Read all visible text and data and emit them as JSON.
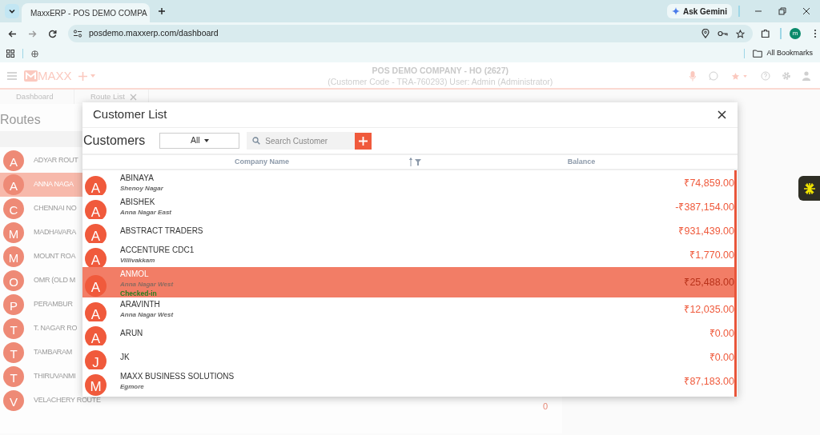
{
  "browser": {
    "tab_title": "MaxxERP - POS DEMO COMPA",
    "ask_gemini": "Ask Gemini",
    "url": "posdemo.maxxerp.com/dashboard",
    "bookmarks_label": "All Bookmarks",
    "profile_initial": "m"
  },
  "app_header": {
    "logo_text": "MAXX",
    "company": "POS DEMO COMPANY - HO (2627)",
    "user_line": "(Customer Code - TRA-760293) User: Admin (Administrator)"
  },
  "tabs": [
    {
      "label": "Dashboard",
      "closable": false
    },
    {
      "label": "Route List",
      "closable": true
    }
  ],
  "routes": {
    "title": "Routes",
    "items": [
      {
        "initial": "A",
        "label": "ADYAR ROUT",
        "selected": false
      },
      {
        "initial": "A",
        "label": "ANNA NAGA",
        "selected": true
      },
      {
        "initial": "C",
        "label": "CHENNAI NO",
        "selected": false
      },
      {
        "initial": "M",
        "label": "MADHAVARA",
        "selected": false
      },
      {
        "initial": "M",
        "label": "MOUNT ROA",
        "selected": false
      },
      {
        "initial": "O",
        "label": "OMR (OLD M",
        "selected": false
      },
      {
        "initial": "P",
        "label": "PERAMBUR",
        "selected": false
      },
      {
        "initial": "T",
        "label": "T. NAGAR RO",
        "selected": false
      },
      {
        "initial": "T",
        "label": "TAMBARAM",
        "selected": false
      },
      {
        "initial": "T",
        "label": "THIRUVANMI",
        "selected": false
      },
      {
        "initial": "V",
        "label": "VELACHERY ROUTE",
        "selected": false,
        "count": "0"
      }
    ]
  },
  "dialog": {
    "title": "Customer List",
    "heading": "Customers",
    "filter": "All",
    "search_placeholder": "Search Customer",
    "columns": [
      "Company Name",
      "Balance"
    ],
    "customers": [
      {
        "initial": "A",
        "name": "ABINAYA",
        "area": "Shenoy Nagar",
        "balance": "₹74,859.00",
        "selected": false
      },
      {
        "initial": "A",
        "name": "ABISHEK",
        "area": "Anna Nagar East",
        "balance": "-₹387,154.00",
        "selected": false
      },
      {
        "initial": "A",
        "name": "ABSTRACT TRADERS",
        "balance": "₹931,439.00",
        "selected": false
      },
      {
        "initial": "A",
        "name": "ACCENTURE CDC1",
        "area": "Villivakkam",
        "balance": "₹1,770.00",
        "selected": false
      },
      {
        "initial": "A",
        "name": "ANMOL",
        "area": "Anna Nagar West",
        "status": "Checked-in",
        "balance": "₹25,488.00",
        "selected": true
      },
      {
        "initial": "A",
        "name": "ARAVINTH",
        "area": "Anna Nagar West",
        "balance": "₹12,035.00",
        "selected": false
      },
      {
        "initial": "A",
        "name": "ARUN",
        "balance": "₹0.00",
        "selected": false
      },
      {
        "initial": "J",
        "name": "JK",
        "balance": "₹0.00",
        "selected": false
      },
      {
        "initial": "M",
        "name": "MAXX BUSINESS SOLUTIONS",
        "area": "Egmore",
        "balance": "₹87,183.00",
        "selected": false
      }
    ]
  }
}
